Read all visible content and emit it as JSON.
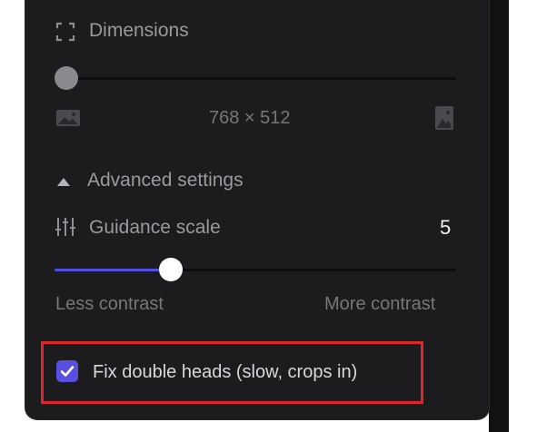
{
  "dimensions": {
    "label": "Dimensions",
    "icon": "expand-icon",
    "size_text": "768 × 512",
    "slider_value": 0
  },
  "advanced": {
    "label": "Advanced settings",
    "expanded": true
  },
  "guidance": {
    "label": "Guidance scale",
    "value": "5",
    "slider_fraction": 0.29,
    "min_label": "Less contrast",
    "max_label": "More contrast"
  },
  "fix_heads": {
    "label": "Fix double heads (slow, crops in)",
    "checked": true
  },
  "colors": {
    "panel_bg": "#1c1c1e",
    "accent": "#5a4fe0",
    "slider_fill": "#4f4fe6",
    "highlight": "#e0262e"
  }
}
